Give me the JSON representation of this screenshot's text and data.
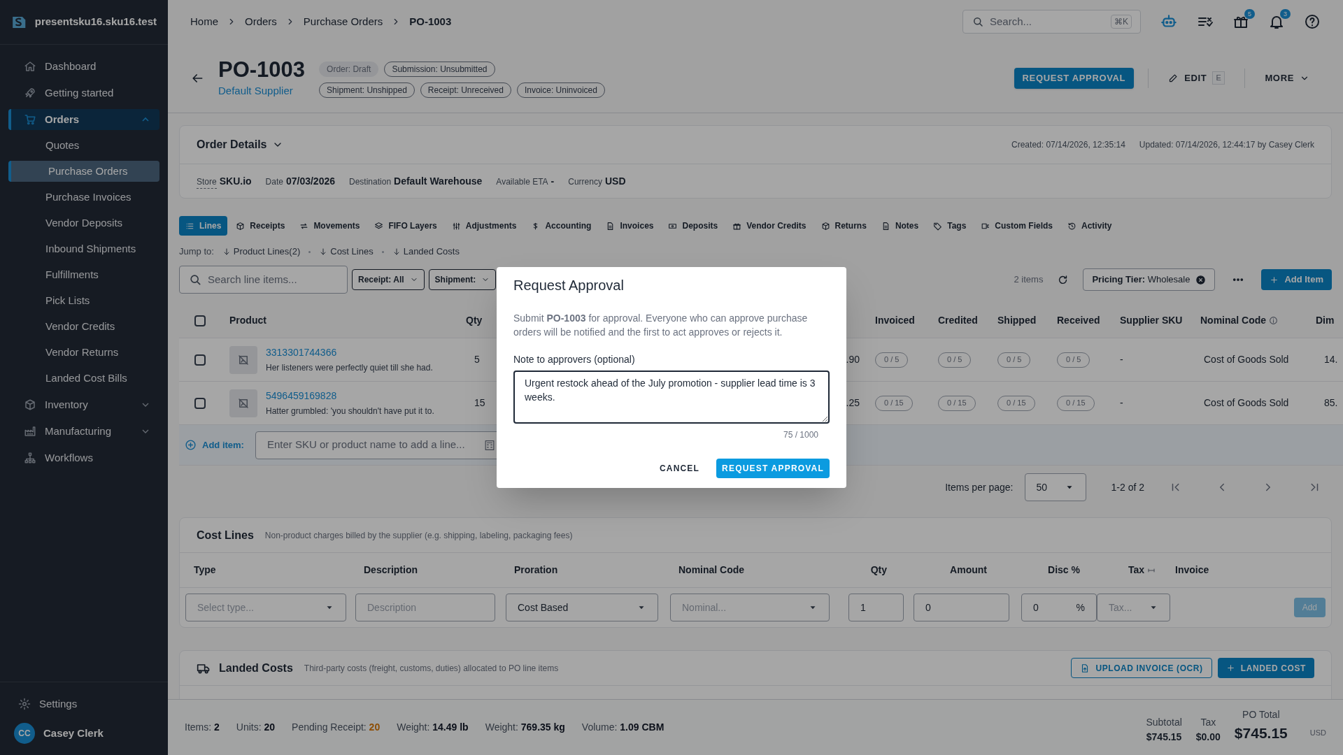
{
  "sidebar": {
    "workspace": "presentsku16.sku16.test",
    "items": [
      {
        "label": "Dashboard",
        "selected": false
      },
      {
        "label": "Getting started",
        "selected": false
      },
      {
        "label": "Orders",
        "selected": true,
        "expanded": true,
        "children": [
          {
            "label": "Quotes",
            "selected": false
          },
          {
            "label": "Purchase Orders",
            "selected": true
          },
          {
            "label": "Purchase Invoices",
            "selected": false
          },
          {
            "label": "Vendor Deposits",
            "selected": false
          },
          {
            "label": "Inbound Shipments",
            "selected": false
          },
          {
            "label": "Fulfillments",
            "selected": false
          },
          {
            "label": "Pick Lists",
            "selected": false
          },
          {
            "label": "Vendor Credits",
            "selected": false
          },
          {
            "label": "Vendor Returns",
            "selected": false
          },
          {
            "label": "Landed Cost Bills",
            "selected": false
          }
        ]
      },
      {
        "label": "Inventory",
        "selected": false,
        "expanded": false
      },
      {
        "label": "Manufacturing",
        "selected": false,
        "expanded": false
      },
      {
        "label": "Workflows",
        "selected": false
      }
    ],
    "settings": "Settings",
    "user": {
      "initials": "CC",
      "name": "Casey Clerk"
    }
  },
  "header": {
    "breadcrumbs": [
      "Home",
      "Orders",
      "Purchase Orders",
      "PO-1003"
    ],
    "search": {
      "placeholder": "Search...",
      "shortcut": "⌘K"
    },
    "gift_badge": "5",
    "bell_badge": "3"
  },
  "title_bar": {
    "title": "PO-1003",
    "supplier": "Default Supplier",
    "badges": [
      {
        "label": "Order: Draft",
        "filled": true
      },
      {
        "label": "Submission: Unsubmitted",
        "filled": false
      },
      {
        "label": "Shipment: Unshipped",
        "filled": false
      },
      {
        "label": "Receipt: Unreceived",
        "filled": false
      },
      {
        "label": "Invoice: Uninvoiced",
        "filled": false
      }
    ],
    "request_button": "REQUEST APPROVAL",
    "edit_button": "EDIT",
    "edit_key": "E",
    "more_button": "MORE"
  },
  "order_details": {
    "title": "Order Details",
    "created": "Created: 07/14/2026, 12:35:14",
    "updated": "Updated: 07/14/2026, 12:44:17 by Casey Clerk",
    "fields": [
      {
        "label": "Store",
        "value": "SKU.io"
      },
      {
        "label": "Date",
        "value": "07/03/2026"
      },
      {
        "label": "Destination",
        "value": "Default Warehouse"
      },
      {
        "label": "Available ETA",
        "value": "-"
      },
      {
        "label": "Currency",
        "value": "USD"
      }
    ]
  },
  "tabs": [
    {
      "label": "Lines",
      "selected": true
    },
    {
      "label": "Receipts",
      "selected": false
    },
    {
      "label": "Movements",
      "selected": false
    },
    {
      "label": "FIFO Layers",
      "selected": false
    },
    {
      "label": "Adjustments",
      "selected": false
    },
    {
      "label": "Accounting",
      "selected": false
    },
    {
      "label": "Invoices",
      "selected": false
    },
    {
      "label": "Deposits",
      "selected": false
    },
    {
      "label": "Vendor Credits",
      "selected": false
    },
    {
      "label": "Returns",
      "selected": false
    },
    {
      "label": "Notes",
      "selected": false
    },
    {
      "label": "Tags",
      "selected": false
    },
    {
      "label": "Custom Fields",
      "selected": false
    },
    {
      "label": "Activity",
      "selected": false
    }
  ],
  "jump_to": {
    "label": "Jump to:",
    "links": [
      "Product Lines(2)",
      "Cost Lines",
      "Landed Costs"
    ]
  },
  "toolbar": {
    "search_placeholder": "Search line items...",
    "filters": [
      "Receipt: All",
      "Shipment:"
    ],
    "count": "2 items",
    "pricing_chip": "**Pricing Tier:** Wholesale",
    "add_button": "Add Item"
  },
  "table": {
    "select_all_checked": false,
    "columns": [
      "Product",
      "Qty",
      "Invoiced",
      "Credited",
      "Shipped",
      "Received",
      "Supplier SKU",
      "Nominal Code",
      "Dim"
    ],
    "rows": [
      {
        "checked": false,
        "sku": "3313301744366",
        "description": "Her listeners were perfectly quiet till she had.",
        "qty": "5",
        "column_4": ".90",
        "invoiced": "0 / 5",
        "credited": "0 / 5",
        "shipped": "0 / 5",
        "received": "0 / 5",
        "supplier_sku": "-",
        "nominal_code": "Cost of Goods Sold",
        "dim": "14."
      },
      {
        "checked": false,
        "sku": "5496459169828",
        "description": "Hatter grumbled: 'you shouldn't have put it to.",
        "qty": "15",
        "column_4": ".25",
        "invoiced": "0 / 15",
        "credited": "0 / 15",
        "shipped": "0 / 15",
        "received": "0 / 15",
        "supplier_sku": "-",
        "nominal_code": "Cost of Goods Sold",
        "dim": "85."
      }
    ],
    "add_item": {
      "label": "Add item:",
      "placeholder": "Enter SKU or product name to add a line..."
    },
    "pagination": {
      "label": "Items per page:",
      "per_page": "50",
      "range": "1-2 of 2"
    }
  },
  "cost_lines": {
    "title": "Cost Lines",
    "subtitle": "Non-product charges billed by the supplier (e.g. shipping, labeling, packaging fees)",
    "columns": [
      "Type",
      "Description",
      "Proration",
      "Nominal Code",
      "Qty",
      "Amount",
      "Disc %",
      "Tax",
      "Invoice"
    ],
    "inputs": [
      {
        "kind": "select",
        "placeholder": "Select type..."
      },
      {
        "kind": "text",
        "placeholder": "Description"
      },
      {
        "kind": "select",
        "value": "Cost Based"
      },
      {
        "kind": "select",
        "placeholder": "Nominal..."
      },
      {
        "kind": "text",
        "value": "1"
      },
      {
        "kind": "text",
        "value": "0"
      },
      {
        "kind": "percent",
        "value": "0",
        "suffix": "%"
      },
      {
        "kind": "select",
        "placeholder": "Tax..."
      }
    ],
    "add_button": {
      "label": "Add",
      "disabled": true
    }
  },
  "landed_costs": {
    "title": "Landed Costs",
    "subtitle": "Third-party costs (freight, customs, duties) allocated to PO line items",
    "upload_button": "UPLOAD INVOICE (OCR)",
    "add_button": "LANDED COST"
  },
  "footer": {
    "stats": [
      {
        "label": "Items:",
        "value": "2",
        "highlight": false
      },
      {
        "label": "Units:",
        "value": "20",
        "highlight": false
      },
      {
        "label": "Pending Receipt:",
        "value": "20",
        "highlight": true
      },
      {
        "label": "Weight:",
        "value": "14.49 lb",
        "highlight": false
      },
      {
        "label": "Weight:",
        "value": "769.35 kg",
        "highlight": false
      },
      {
        "label": "Volume:",
        "value": "1.09 CBM",
        "highlight": false
      }
    ],
    "subtotal_label": "Subtotal",
    "subtotal": "$745.15",
    "tax_label": "Tax",
    "tax": "$0.00",
    "total_label": "PO Total",
    "total": "$745.15",
    "currency": "USD"
  },
  "modal": {
    "title": "Request Approval",
    "body": "Submit **PO-1003** for approval. Everyone who can approve purchase orders will be notified and the first to act approves or rejects it.",
    "note_label": "Note to approvers (optional)",
    "note_value": "Urgent restock ahead of the July promotion - supplier lead time is 3 weeks.",
    "counter": "75 / 1000",
    "cancel": "CANCEL",
    "confirm": "REQUEST APPROVAL"
  }
}
